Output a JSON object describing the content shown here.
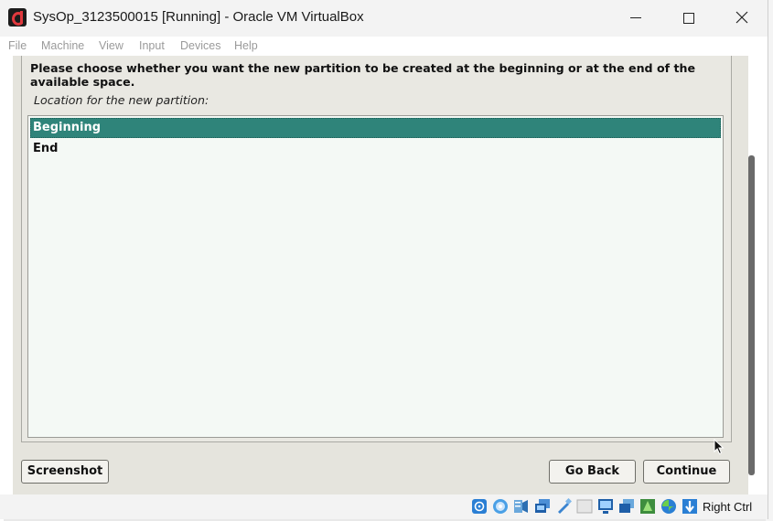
{
  "window": {
    "title": "SysOp_3123500015 [Running] - Oracle VM VirtualBox"
  },
  "menubar": {
    "items": [
      "File",
      "Machine",
      "View",
      "Input",
      "Devices",
      "Help"
    ]
  },
  "installer": {
    "question": "Please choose whether you want the new partition to be created at the beginning or at the end of the available space.",
    "list_label": "Location for the new partition:",
    "options": [
      {
        "label": "Beginning",
        "selected": true
      },
      {
        "label": "End",
        "selected": false
      }
    ],
    "buttons": {
      "screenshot": "Screenshot",
      "go_back": "Go Back",
      "continue": "Continue"
    }
  },
  "statusbar": {
    "icons": [
      "hard-disk-icon",
      "optical-drive-icon",
      "audio-icon",
      "network-icon",
      "usb-icon",
      "shared-folders-icon",
      "display-icon",
      "video-capture-icon",
      "mouse-integration-icon",
      "cpu-activity-icon",
      "keyboard-capture-icon"
    ],
    "host_key": "Right Ctrl"
  },
  "colors": {
    "selection": "#2f847a",
    "list_background": "#f4f9f5",
    "installer_background": "#e5e4dd"
  }
}
